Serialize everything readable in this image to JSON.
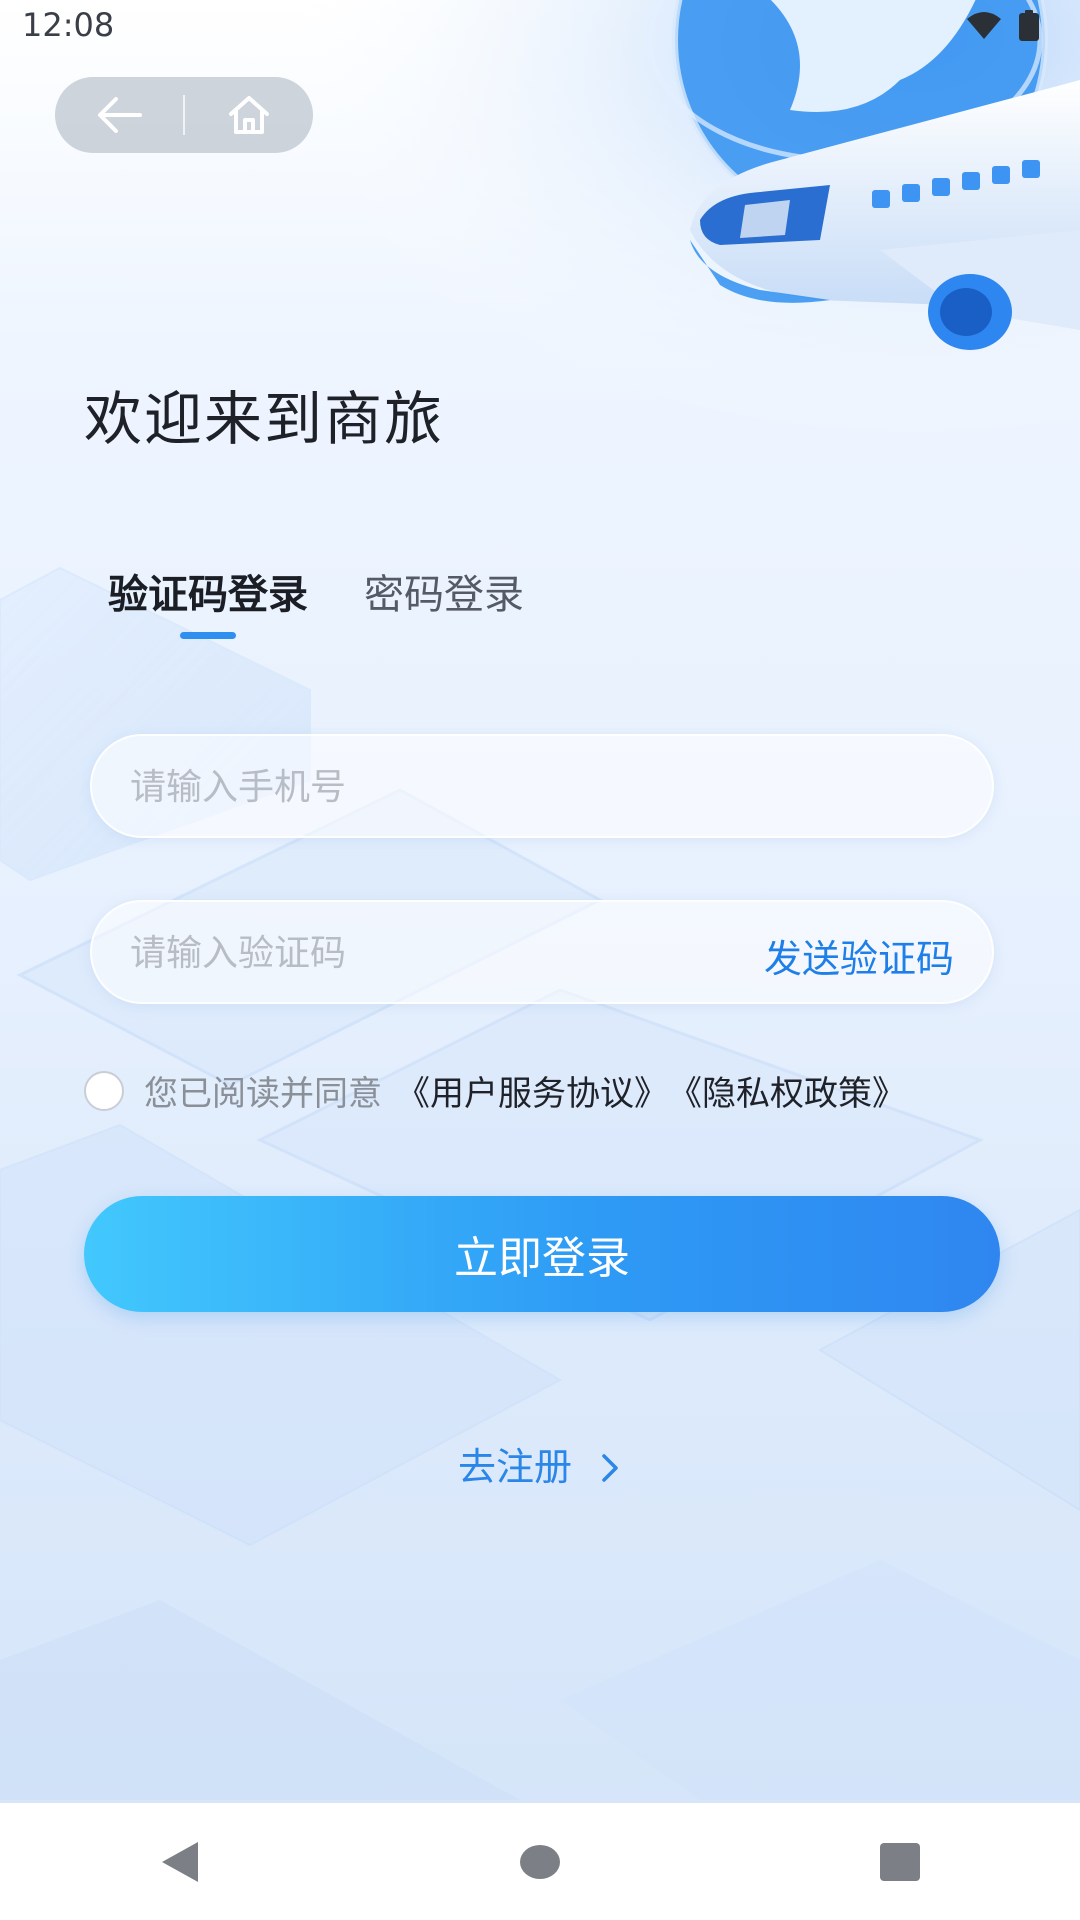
{
  "status_bar": {
    "time": "12:08"
  },
  "nav_capsule": {
    "back_icon": "arrow-left-icon",
    "home_icon": "home-icon"
  },
  "welcome": {
    "title": "欢迎来到商旅"
  },
  "tabs": [
    {
      "label": "验证码登录",
      "active": true
    },
    {
      "label": "密码登录",
      "active": false
    }
  ],
  "form": {
    "phone_placeholder": "请输入手机号",
    "code_placeholder": "请输入验证码",
    "send_code_label": "发送验证码"
  },
  "agreement": {
    "prefix": "您已阅读并同意",
    "user_agreement": "《用户服务协议》",
    "privacy_policy": "《隐私权政策》",
    "checked": false
  },
  "login_button": {
    "label": "立即登录"
  },
  "register_link": {
    "label": "去注册"
  },
  "colors": {
    "accent": "#2f8ff0",
    "link": "#1f7fe8",
    "button_start": "#42c8fd",
    "button_end": "#2f86f0"
  }
}
